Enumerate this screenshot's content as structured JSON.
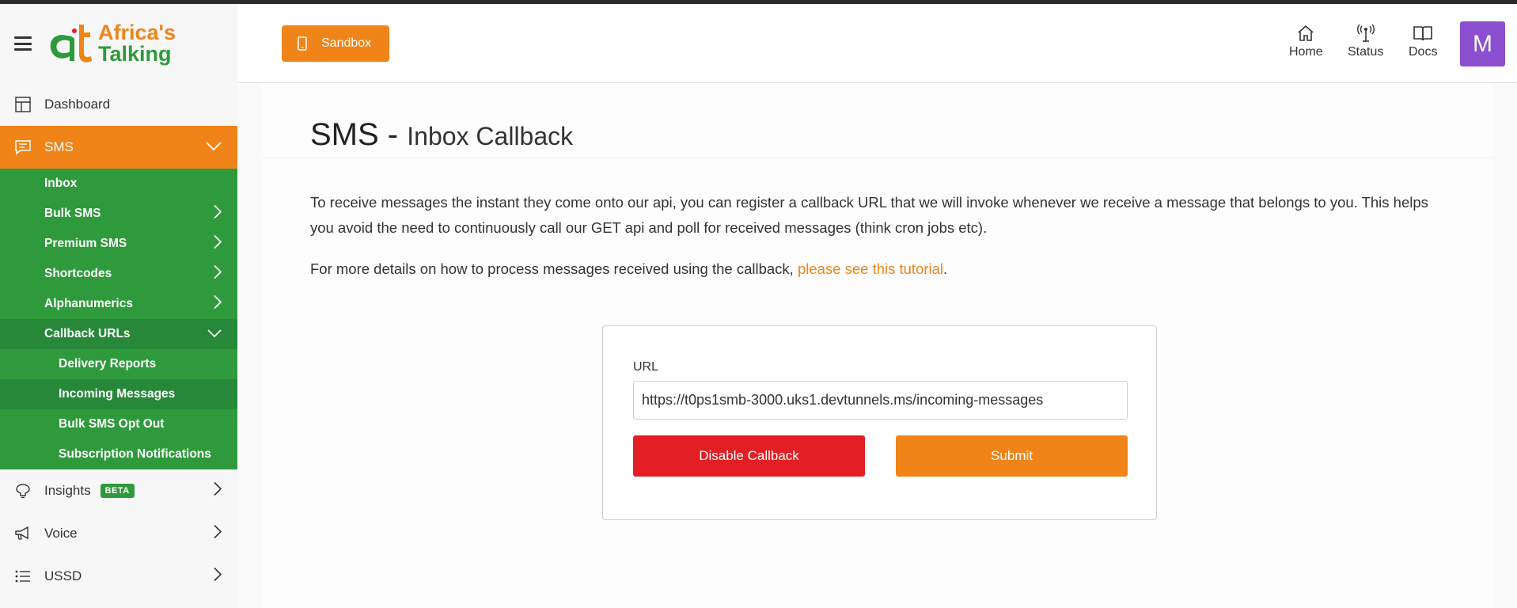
{
  "brand": {
    "logo_line1": "Africa's",
    "logo_line2": "Talking",
    "colors": {
      "orange": "#f08418",
      "green": "#2f9a3c",
      "red": "#e31e24",
      "avatar": "#8b4fcf"
    }
  },
  "sidebar": {
    "dashboard": "Dashboard",
    "sms": "SMS",
    "sms_items": [
      {
        "label": "Inbox"
      },
      {
        "label": "Bulk SMS"
      },
      {
        "label": "Premium SMS"
      },
      {
        "label": "Shortcodes"
      },
      {
        "label": "Alphanumerics"
      },
      {
        "label": "Callback URLs"
      }
    ],
    "callback_items": [
      {
        "label": "Delivery Reports"
      },
      {
        "label": "Incoming Messages"
      },
      {
        "label": "Bulk SMS Opt Out"
      },
      {
        "label": "Subscription Notifications"
      }
    ],
    "insights": "Insights",
    "insights_badge": "BETA",
    "voice": "Voice",
    "ussd": "USSD"
  },
  "header": {
    "sandbox": "Sandbox",
    "home": "Home",
    "status": "Status",
    "docs": "Docs",
    "avatar_initial": "M"
  },
  "main": {
    "title": "SMS -",
    "subtitle": "Inbox Callback",
    "paragraph1": "To receive messages the instant they come onto our api, you can register a callback URL that we will invoke whenever we receive a message that belongs to you. This helps you avoid the need to continuously call our GET api and poll for received messages (think cron jobs etc).",
    "paragraph2_prefix": "For more details on how to process messages received using the callback,",
    "paragraph2_link": "please see this tutorial",
    "paragraph2_suffix": ".",
    "form": {
      "url_label": "URL",
      "url_value": "https://t0ps1smb-3000.uks1.devtunnels.ms/incoming-messages",
      "disable_label": "Disable Callback",
      "submit_label": "Submit"
    }
  }
}
